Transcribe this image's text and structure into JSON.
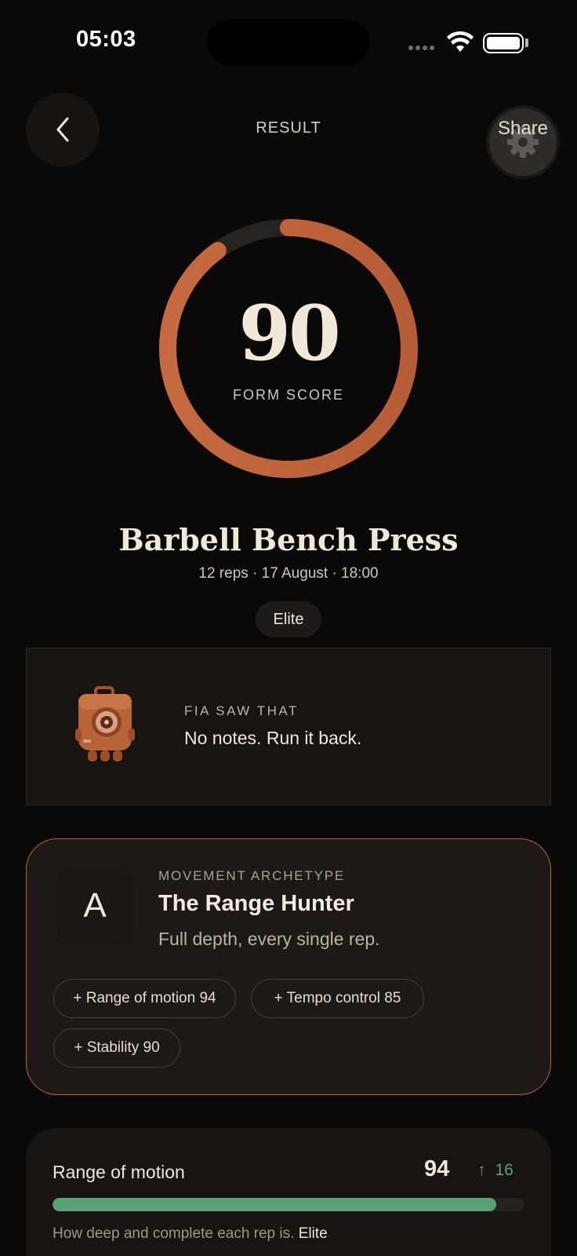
{
  "status_bar": {
    "time": "05:03"
  },
  "header": {
    "title": "RESULT",
    "share_label": "Share"
  },
  "score": {
    "value": "90",
    "label": "FORM SCORE",
    "ring_fraction": 0.9
  },
  "exercise": {
    "name": "Barbell Bench Press",
    "meta": "12 reps · 17 August · 18:00",
    "level": "Elite"
  },
  "fia": {
    "eyebrow": "FIA SAW THAT",
    "message": "No notes. Run it back."
  },
  "archetype": {
    "letter": "A",
    "eyebrow": "MOVEMENT ARCHETYPE",
    "title": "The Range Hunter",
    "description": "Full depth, every single rep.",
    "tags": [
      "+ Range of motion 94",
      "+ Tempo control 85",
      "+ Stability 90"
    ]
  },
  "metric": {
    "name": "Range of motion",
    "value": "94",
    "delta": "16",
    "delta_arrow": "↑",
    "bar_fraction": 0.94,
    "note": "How deep and complete each rep is.",
    "note_level": "Elite"
  },
  "colors": {
    "accent": "#c2673f",
    "positive": "#5aa276",
    "background": "#0b0908"
  },
  "icons": {
    "back": "chevron-left-icon",
    "share": "gear-icon",
    "wifi": "wifi-icon",
    "battery": "battery-icon"
  }
}
